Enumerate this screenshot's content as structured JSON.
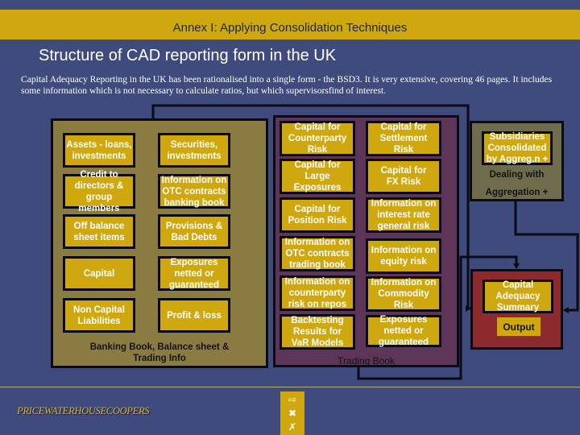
{
  "header": {
    "title": "Annex I: Applying Consolidation Techniques"
  },
  "slide": {
    "title": "Structure of CAD reporting form in the UK",
    "intro": "Capital Adequacy Reporting in the UK has been rationalised into a single form - the BSD3.  It is very extensive, covering 46 pages.  It includes some information which is not necessary to calculate ratios, but which supervisorsfind of interest."
  },
  "banking_panel": {
    "caption_line1": "Banking Book, Balance sheet &",
    "caption_line2": "Trading Info",
    "boxes": [
      {
        "lines": [
          "Assets - loans,",
          "investments"
        ]
      },
      {
        "lines": [
          "Securities,",
          "investments"
        ]
      },
      {
        "lines": [
          "Credit to",
          "directors &",
          "group members"
        ]
      },
      {
        "lines": [
          "Information on",
          "OTC contracts",
          "banking book"
        ]
      },
      {
        "lines": [
          "Off balance",
          "sheet items"
        ]
      },
      {
        "lines": [
          "Provisions &",
          "Bad Debts"
        ]
      },
      {
        "lines": [
          "Capital"
        ]
      },
      {
        "lines": [
          "Exposures",
          "netted or",
          "guaranteed"
        ]
      },
      {
        "lines": [
          "Non Capital",
          "Liabilities"
        ]
      },
      {
        "lines": [
          "Profit & loss"
        ]
      }
    ]
  },
  "trading_panel": {
    "caption": "Trading Book",
    "boxes": [
      {
        "lines": [
          "Capital for",
          "Counterparty",
          "Risk"
        ]
      },
      {
        "lines": [
          "Capital for",
          "Settlement",
          "Risk"
        ]
      },
      {
        "lines": [
          "Capital for",
          "Large",
          "Exposures"
        ]
      },
      {
        "lines": [
          "Capital for",
          "FX Risk"
        ]
      },
      {
        "lines": [
          "Capital for",
          "Position  Risk"
        ]
      },
      {
        "lines": [
          "Information on",
          "interest rate",
          "general risk"
        ]
      },
      {
        "lines": [
          "Information on",
          "OTC contracts",
          "trading book"
        ]
      },
      {
        "lines": [
          "Information on",
          "equity risk"
        ]
      },
      {
        "lines": [
          "Information on",
          "counterparty",
          "risk on repos"
        ]
      },
      {
        "lines": [
          "Information on",
          "Commodity",
          "Risk"
        ]
      },
      {
        "lines": [
          "Backtesting",
          "Results for",
          "VaR Models"
        ]
      },
      {
        "lines": [
          "Exposures",
          "netted or",
          "guaranteed"
        ]
      }
    ]
  },
  "subsidiaries_panel": {
    "box_lines": [
      "Subsidiaries",
      "Consolidated",
      "by Aggreg.n +"
    ],
    "caption_line1": "Dealing with",
    "caption_line2": "Aggregation +"
  },
  "summary_panel": {
    "box_lines": [
      "Capital",
      "Adequacy",
      "Summary"
    ],
    "output_label": "Output"
  },
  "footer": {
    "logo_text": "PRICEWATERHOUSECOOPERS",
    "nav": [
      {
        "icon": "return-icon",
        "glyph": "⇨"
      },
      {
        "icon": "close-x-icon",
        "glyph": "✖"
      },
      {
        "icon": "exit-icon",
        "glyph": "✗"
      }
    ]
  },
  "colors": {
    "background": "#3f4a7d",
    "accent_gold": "#cfa70e",
    "banking_panel": "#8a7b43",
    "trading_panel": "#5c3558",
    "subsidiaries_panel": "#6e6c4c",
    "summary_panel": "#8c2a2d"
  }
}
